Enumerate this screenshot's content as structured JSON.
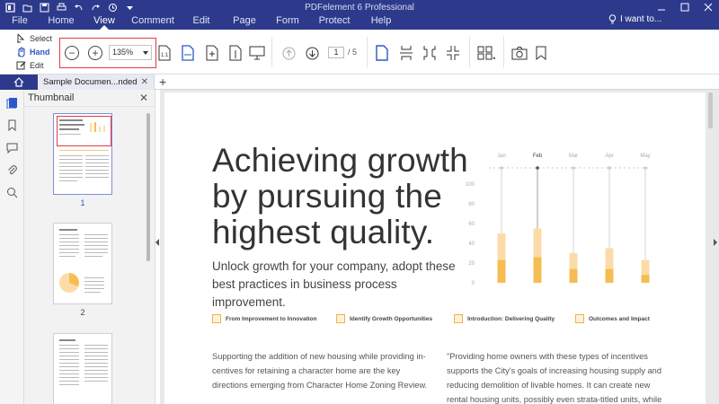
{
  "app": {
    "title": "PDFelement 6 Professional"
  },
  "menu": {
    "items": [
      "File",
      "Home",
      "View",
      "Comment",
      "Edit",
      "Page",
      "Form",
      "Protect",
      "Help"
    ],
    "active": "View"
  },
  "search": {
    "label": "I want to..."
  },
  "ribbon": {
    "modes": [
      "Select",
      "Hand",
      "Edit"
    ],
    "zoom_value": "135%",
    "page_current": "1",
    "page_total": "/ 5"
  },
  "tabs": {
    "document": "Sample Documen...nded"
  },
  "panel": {
    "title": "Thumbnail",
    "pages": [
      "1",
      "2"
    ]
  },
  "document": {
    "heading": [
      "Achieving growth",
      "by pursuing the",
      "highest quality."
    ],
    "subheading": "Unlock growth for your company, adopt these best practices in business process improvement.",
    "tags": [
      "From Improvement to Innovation",
      "Identify Growth Opportunities",
      "Introduction: Delivering Quality",
      "Outcomes and Impact"
    ],
    "body_left": "Supporting the addition of new housing while providing in-centives for retaining a character home are the key directions emerging from Character Home Zoning Review.",
    "body_right": "\"Providing home owners with these types of incentives supports the City's goals of increasing housing supply and reducing demolition of livable homes.  It can create new rental housing units, possibly even strata-titled units, while"
  },
  "chart_data": {
    "type": "bar",
    "categories": [
      "Jan",
      "Feb",
      "Mar",
      "Apr",
      "May"
    ],
    "highlight_category": "Feb",
    "y_ticks": [
      "100",
      "80",
      "60",
      "40",
      "20",
      "0"
    ],
    "ylim": [
      0,
      100
    ],
    "series": [
      {
        "values": [
          50,
          55,
          30,
          35,
          23
        ]
      },
      {
        "values": [
          23,
          26,
          14,
          14,
          8
        ]
      }
    ],
    "colors": {
      "light": "#fbdca8",
      "dark": "#f6bd52"
    }
  }
}
